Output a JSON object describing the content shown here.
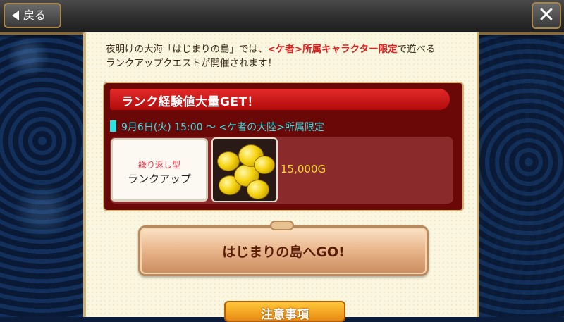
{
  "header": {
    "back_label": "戻る",
    "close_icon": "close-icon",
    "back_icon": "arrow-left-icon"
  },
  "intro": {
    "line1_a": "夜明けの大海「はじまりの島」では、",
    "line1_highlight": "<ケ者>所属キャラクター限定",
    "line1_b": "で遊べる",
    "line2": "ランクアップクエストが開催されます！"
  },
  "event": {
    "title": "ランク経験値大量GET！",
    "subtitle": "9月6日(火) 15:00 〜 <ケ者の大陸>所属限定",
    "quest_type_top": "繰り返し型",
    "quest_type_bottom": "ランクアップ",
    "reward_icon": "gold-coins-icon",
    "reward_value": "15,000G"
  },
  "go_button": {
    "label": "はじまりの島へGO!"
  },
  "notice": {
    "label": "注意事項"
  },
  "colors": {
    "accent_red": "#e01e1e",
    "cyan": "#37e1e6",
    "gold_text": "#f8dd2a",
    "card_bg": "#6a0707"
  }
}
